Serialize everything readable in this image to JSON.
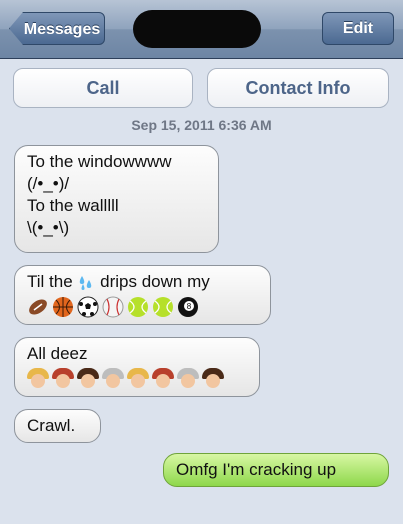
{
  "navbar": {
    "back_label": "Messages",
    "edit_label": "Edit"
  },
  "actions": {
    "call_label": "Call",
    "contact_info_label": "Contact Info"
  },
  "timestamp": "Sep 15, 2011 6:36 AM",
  "messages": [
    {
      "direction": "incoming",
      "lines": [
        "To the windowwww",
        "(/•_•)/",
        "To the walllll",
        "\\(•_•\\)"
      ]
    },
    {
      "direction": "incoming",
      "line1_before": "Til the",
      "line1_after": "drips down my",
      "emojis": [
        "football-emoji",
        "basketball-emoji",
        "soccer-ball-emoji",
        "baseball-emoji",
        "tennis-ball-emoji",
        "tennis-ball-emoji",
        "8-ball-emoji"
      ]
    },
    {
      "direction": "incoming",
      "text": "All deez",
      "emojis": [
        "princess-emoji",
        "woman-emoji",
        "girl-emoji",
        "old-woman-emoji",
        "princess-emoji",
        "woman-emoji",
        "old-woman-emoji",
        "girl-emoji"
      ]
    },
    {
      "direction": "incoming",
      "text": "Crawl."
    },
    {
      "direction": "outgoing",
      "text": "Omfg I'm cracking up"
    }
  ]
}
